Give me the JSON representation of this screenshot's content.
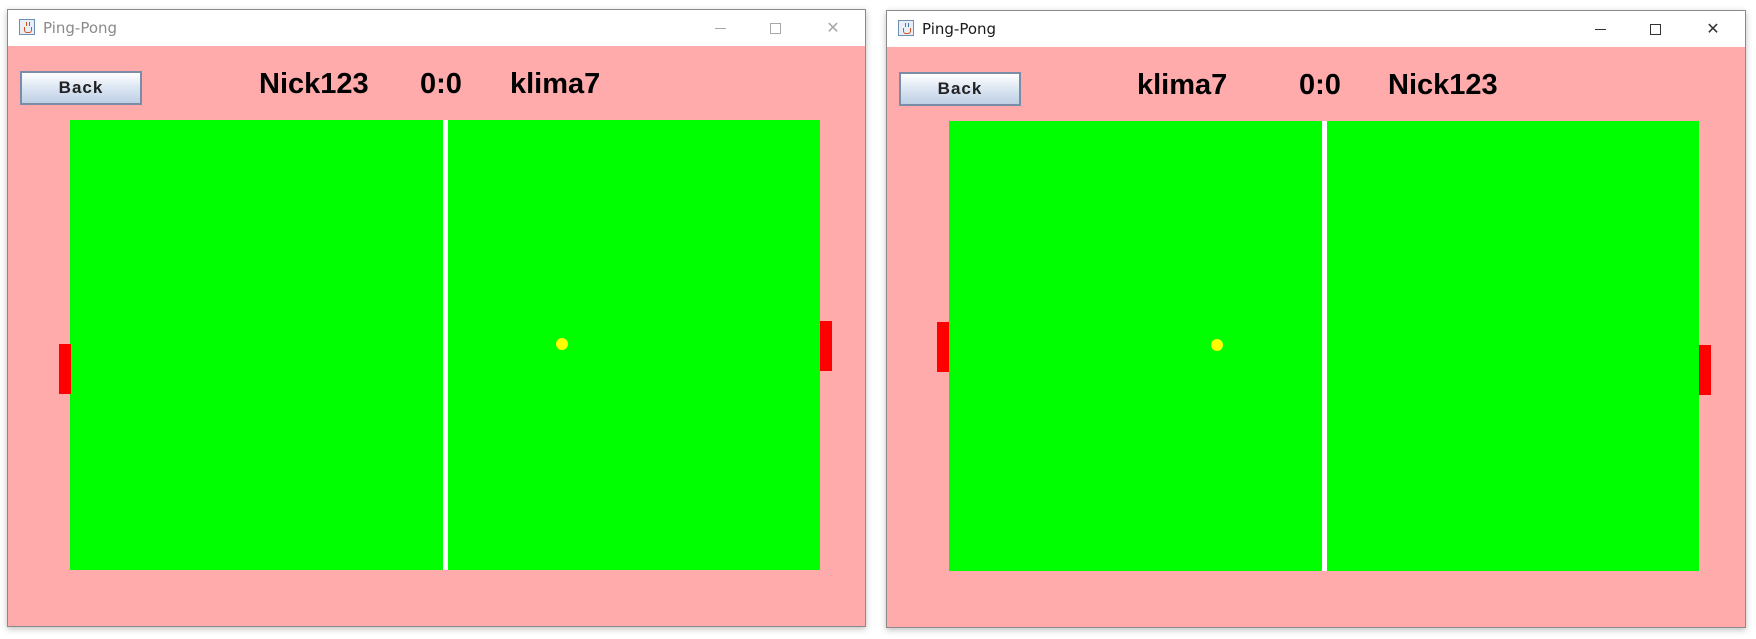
{
  "windows": [
    {
      "title": "Ping-Pong",
      "active": false,
      "back_label": "Back",
      "left_player": "Nick123",
      "score": "0:0",
      "right_player": "klima7"
    },
    {
      "title": "Ping-Pong",
      "active": true,
      "back_label": "Back",
      "left_player": "klima7",
      "score": "0:0",
      "right_player": "Nick123"
    }
  ],
  "colors": {
    "background": "#ffabab",
    "table": "#00ff00",
    "net": "#ffffff",
    "ball": "#ffff00",
    "paddle": "#ff0000"
  },
  "icons": [
    "app-icon",
    "minimize-icon",
    "maximize-icon",
    "close-icon"
  ]
}
